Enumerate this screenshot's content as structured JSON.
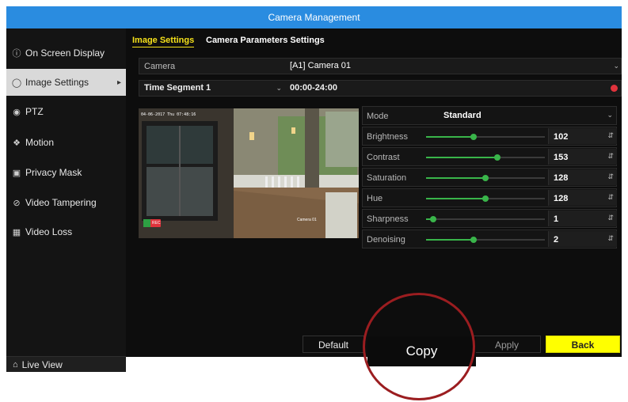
{
  "window": {
    "title": "Camera Management"
  },
  "sidebar": {
    "items": [
      {
        "label": "On Screen Display",
        "icon": "info-icon"
      },
      {
        "label": "Image Settings",
        "icon": "image-settings-icon",
        "active": true
      },
      {
        "label": "PTZ",
        "icon": "ptz-icon"
      },
      {
        "label": "Motion",
        "icon": "motion-icon"
      },
      {
        "label": "Privacy Mask",
        "icon": "privacy-mask-icon"
      },
      {
        "label": "Video Tampering",
        "icon": "video-tampering-icon"
      },
      {
        "label": "Video Loss",
        "icon": "video-loss-icon"
      }
    ],
    "live_view": "Live View"
  },
  "tabs": [
    {
      "label": "Image Settings",
      "active": true
    },
    {
      "label": "Camera Parameters Settings"
    }
  ],
  "camera": {
    "label": "Camera",
    "value": "[A1] Camera 01"
  },
  "time_segment": {
    "value": "Time Segment 1",
    "range": "00:00-24:00"
  },
  "preview": {
    "timestamp": "04-06-2017  Thu 07:48:16",
    "caption": "Camera 01",
    "rec": "REC"
  },
  "mode": {
    "label": "Mode",
    "value": "Standard"
  },
  "params": [
    {
      "label": "Brightness",
      "value": "102",
      "level": 0.4
    },
    {
      "label": "Contrast",
      "value": "153",
      "level": 0.6
    },
    {
      "label": "Saturation",
      "value": "128",
      "level": 0.5
    },
    {
      "label": "Hue",
      "value": "128",
      "level": 0.5
    },
    {
      "label": "Sharpness",
      "value": "1",
      "level": 0.06
    },
    {
      "label": "Denoising",
      "value": "2",
      "level": 0.4
    }
  ],
  "buttons": {
    "default": "Default",
    "copy": "Copy",
    "apply": "Apply",
    "back": "Back"
  },
  "colors": {
    "title_bar": "#2a8ce0",
    "tab_active": "#f5e11b",
    "slider": "#39b54a",
    "back_button": "#ffff00",
    "highlight_circle": "#9b1d20"
  }
}
